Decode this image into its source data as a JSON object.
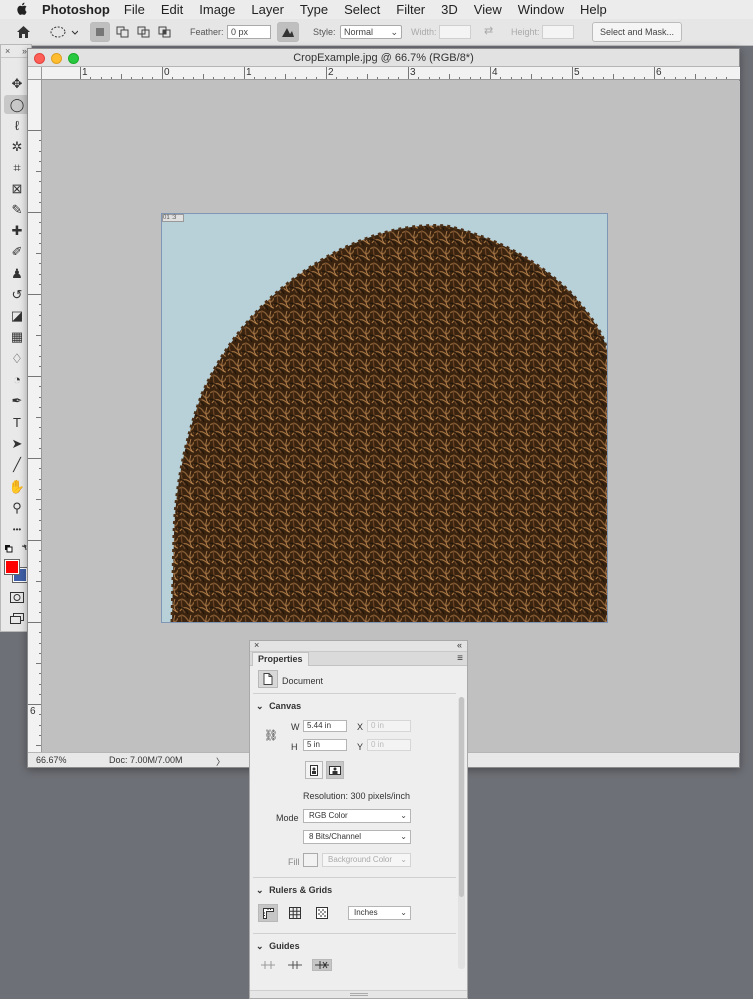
{
  "menubar": {
    "apple": "",
    "app_name": "Photoshop",
    "items": [
      "File",
      "Edit",
      "Image",
      "Layer",
      "Type",
      "Select",
      "Filter",
      "3D",
      "View",
      "Window",
      "Help"
    ]
  },
  "options_bar": {
    "feather_label": "Feather:",
    "feather_value": "0 px",
    "style_label": "Style:",
    "style_value": "Normal",
    "width_label": "Width:",
    "height_label": "Height:",
    "select_mask_label": "Select and Mask..."
  },
  "tools_panel": {
    "tools": [
      {
        "name": "move-tool",
        "glyph": "✥"
      },
      {
        "name": "elliptical-marquee-tool",
        "glyph": "◯",
        "selected": true
      },
      {
        "name": "lasso-tool",
        "glyph": "ℓ"
      },
      {
        "name": "magic-wand-tool",
        "glyph": "✲"
      },
      {
        "name": "crop-tool",
        "glyph": "⌗"
      },
      {
        "name": "frame-tool",
        "glyph": "⊠"
      },
      {
        "name": "eyedropper-tool",
        "glyph": "✎"
      },
      {
        "name": "healing-brush-tool",
        "glyph": "✚"
      },
      {
        "name": "brush-tool",
        "glyph": "✐"
      },
      {
        "name": "clone-stamp-tool",
        "glyph": "♟"
      },
      {
        "name": "history-brush-tool",
        "glyph": "↺"
      },
      {
        "name": "eraser-tool",
        "glyph": "◪"
      },
      {
        "name": "gradient-tool",
        "glyph": "▦"
      },
      {
        "name": "blur-tool",
        "glyph": "♢"
      },
      {
        "name": "dodge-tool",
        "glyph": "◔"
      },
      {
        "name": "pen-tool",
        "glyph": "✒"
      },
      {
        "name": "type-tool",
        "glyph": "T"
      },
      {
        "name": "path-selection-tool",
        "glyph": "➤"
      },
      {
        "name": "line-tool",
        "glyph": "╱"
      },
      {
        "name": "hand-tool",
        "glyph": "✋"
      },
      {
        "name": "zoom-tool",
        "glyph": "⚲"
      },
      {
        "name": "more-tools",
        "glyph": "•••"
      }
    ],
    "foreground_color": "#ff0000",
    "background_color": "#3f5fa8"
  },
  "document": {
    "title": "CropExample.jpg @ 66.7% (RGB/8*)",
    "zoom": "66.67%",
    "doc_info": "Doc: 7.00M/7.00M",
    "status_arrow": "〉",
    "ruler_h_numbers": [
      "1",
      "0",
      "1",
      "2",
      "3",
      "4",
      "5",
      "6"
    ],
    "ruler_v_number": "6",
    "image_sky_color": "#b8d0d8",
    "image_hair_color": "#5a3a1c",
    "canvas_badge": "01 :3"
  },
  "properties": {
    "tab": "Properties",
    "doc_label": "Document",
    "canvas": {
      "title": "Canvas",
      "w_label": "W",
      "w_value": "5.44 in",
      "h_label": "H",
      "h_value": "5 in",
      "x_label": "X",
      "x_placeholder": "0 in",
      "y_label": "Y",
      "y_placeholder": "0 in",
      "resolution": "Resolution: 300 pixels/inch",
      "mode_label": "Mode",
      "mode_value": "RGB Color",
      "depth_value": "8 Bits/Channel",
      "fill_label": "Fill",
      "fill_value": "Background Color"
    },
    "rulers": {
      "title": "Rulers & Grids",
      "unit_value": "Inches"
    },
    "guides": {
      "title": "Guides"
    }
  }
}
